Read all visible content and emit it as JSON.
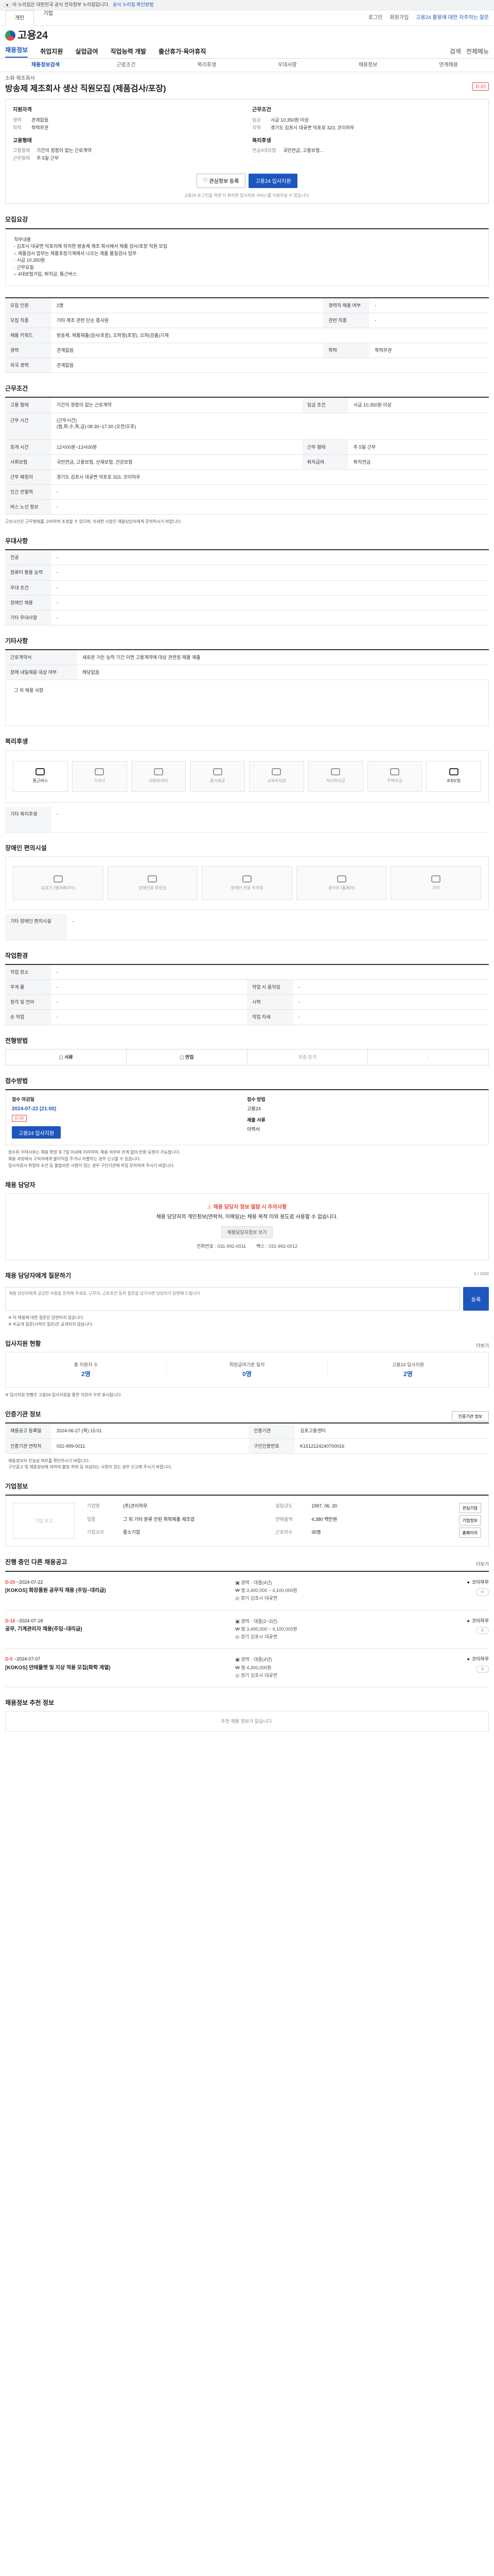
{
  "gov_banner": {
    "text": "이 누리집은 대한민국 공식 전자정부 누리집입니다.",
    "link": "공식 누리집 확인방법"
  },
  "util": {
    "tabs": [
      "개인",
      "기업"
    ],
    "right": [
      "로그인",
      "회원가입",
      "고용24 활용에 대한 자주하는 질문"
    ],
    "notice": "로그인 없이 이용"
  },
  "logo": "고용24",
  "gnb": {
    "items": [
      "채용정보",
      "취업지원",
      "실업급여",
      "직업능력 개발",
      "출산휴가·육아휴직"
    ],
    "icons": [
      "검색",
      "전체메뉴"
    ]
  },
  "subnav": [
    "채용정보검색",
    "근로조건",
    "복리후생",
    "우대사항",
    "채용정보",
    "연계채용"
  ],
  "posting": {
    "company": "소화 제조회사",
    "title": "방송제 제조회사 생산 직원모집 (제품검사/포장)",
    "dday": "D-20"
  },
  "summary": {
    "left_title": "지원자격",
    "left": [
      {
        "k": "경력",
        "v": "관계없음"
      },
      {
        "k": "학력",
        "v": "학력무관"
      }
    ],
    "right_title": "근무조건",
    "right": [
      {
        "k": "임금",
        "v": "시급 10,350원 이상"
      },
      {
        "k": "지역",
        "v": "경기도 김포시 대곶면 덕포로 323, 코이하우"
      }
    ],
    "employ_title": "고용형태",
    "employ": [
      {
        "k": "고용형태",
        "v": "기간의 정함이 없는 근로계약"
      },
      {
        "k": "근무형태",
        "v": "주 5일 근무"
      }
    ],
    "welfare_title": "복리후생",
    "welfare": [
      {
        "k": "연금4대보험",
        "v": "국민연금, 고용보험..."
      }
    ],
    "btn_scrap": "관심정보 등록",
    "btn_apply": "고용24 입사지원",
    "note": "고용24 로그인을 하면 더 편리한 입사지원 서비스를 이용하실 수 있습니다."
  },
  "job_desc": {
    "title": "모집요강",
    "body": "직무내용\n- 김포시 대곶면 덕포리에 위치한 방송제 제조 회사에서 제품 검사/포장 직원 모집\n  ○ 제품검사 업무는 제품포장기계에서 나오는 제품 품질검사 업무\n    · 시급 10,350원\n    · 근무요일\n  ○ 4대보험가입, 퇴직금, 통근버스"
  },
  "recruit": {
    "title": "모집요강",
    "rows": [
      {
        "k": "모집 인원",
        "v": "2명",
        "k2": "경력직 채용 여부",
        "v2": "-"
      },
      {
        "k": "모집 직종",
        "v": "기타 제조 관련 단순 종사원",
        "k2": "관련 직종",
        "v2": "-"
      },
      {
        "k": "채용 키워드",
        "v": "방송제, 제품제출(검사/포장), 오퍼정(포장), 오퍼(검출)기계",
        "k2": "",
        "v2": ""
      },
      {
        "k": "경력",
        "v": "관계없음",
        "k2": "학력",
        "v2": "학력무관"
      },
      {
        "k": "외국 경력",
        "v": "관계없음",
        "k2": "",
        "v2": ""
      }
    ]
  },
  "conditions": {
    "title": "근무조건",
    "rows": [
      {
        "k": "고용 형태",
        "v": "기간의 정함이 없는 근로계약",
        "k2": "임금 조건",
        "v2": "시급 10,350원 이상"
      },
      {
        "k": "근무 시간",
        "v": "(근무시간)\n(월,화,수,목,금) 08:30~17:30 (오전/오후)",
        "k2": "",
        "v2": ""
      },
      {
        "k": "휴게 시간",
        "v": "12시00분~13시00분",
        "k2": "근무 형태",
        "v2": "주 5일 근무"
      },
      {
        "k": "사회보험",
        "v": "국민연금, 고용보험, 산재보험, 건강보험",
        "k2": "퇴직급여",
        "v2": "퇴직연금"
      },
      {
        "k": "근무 예정지",
        "v": "경기도 김포시 대곶면 덕포로 323, 코이하우",
        "k2": "",
        "v2": ""
      },
      {
        "k": "인근 전철역",
        "v": "-",
        "k2": "",
        "v2": ""
      },
      {
        "k": "버스 노선 정보",
        "v": "-",
        "k2": "",
        "v2": ""
      }
    ],
    "note": "근로시간은 근무형태를 고려하여 조정할 수 있으며, 자세한 사항은 채용담당자에게 문의하시기 바랍니다."
  },
  "prefer": {
    "title": "우대사항",
    "rows": [
      {
        "k": "전공",
        "v": "-"
      },
      {
        "k": "컴퓨터 활용 능력",
        "v": "-"
      },
      {
        "k": "우대 조건",
        "v": "-"
      },
      {
        "k": "장애인 채용",
        "v": "-"
      },
      {
        "k": "기타 우대사항",
        "v": "-"
      }
    ]
  },
  "etc": {
    "title": "기타사항",
    "rows": [
      {
        "k": "근로계약서",
        "v": "새로운 거든 능력 기간 이면 고용계약에 대상 관련된 제품 제출"
      },
      {
        "k": "장애 내일채움 대상 여부",
        "v": "해당없음"
      }
    ],
    "more": "그 외 채용 사항"
  },
  "welfare": {
    "title": "복리후생",
    "items": [
      {
        "label": "통근버스",
        "on": true
      },
      {
        "label": "기숙사",
        "on": false
      },
      {
        "label": "차량유지비",
        "on": false
      },
      {
        "label": "중식제공",
        "on": false
      },
      {
        "label": "교육비지원",
        "on": false
      },
      {
        "label": "자녀학자금",
        "on": false
      },
      {
        "label": "주택자금",
        "on": false
      },
      {
        "label": "4대보험",
        "on": true
      }
    ],
    "etc_label": "기타 복리후생",
    "etc_value": "-"
  },
  "disabled": {
    "title": "장애인 편의시설",
    "items": [
      "승강기 (엘리베이터)",
      "장애인용 화장실",
      "장애인 전용 주차장",
      "경사로 (휠체어)",
      "기타"
    ],
    "etc_label": "기타 장애인 편의시설",
    "etc_value": "-"
  },
  "work_env": {
    "title": "작업환경",
    "rows": [
      {
        "k": "작업 장소",
        "v": "-",
        "k2": "",
        "v2": ""
      },
      {
        "k": "무게 물",
        "v": "-",
        "k2": "작업 시 움직임",
        "v2": "-"
      },
      {
        "k": "청각 및 언어",
        "v": "-",
        "k2": "시력",
        "v2": "-"
      },
      {
        "k": "손 작업",
        "v": "-",
        "k2": "작업 자세",
        "v2": "-"
      }
    ]
  },
  "process": {
    "title": "전형방법",
    "steps": [
      "서류",
      "면접",
      "최종 합격",
      "-"
    ]
  },
  "apply": {
    "title": "접수방법",
    "col1_title": "접수 마감일",
    "date": "2024-07-22 (21:00)",
    "dday": "D-20",
    "col2_title": "접수 방법",
    "method": "고용24",
    "docs_title": "제출 서류",
    "docs": "이력서",
    "btn": "고용24 입사지원",
    "notes": [
      "접수된 이력서류는 채용 확정 후 7일 이내에 처리하며, 채용 여부와 관계 없이 반환 요청이 가능합니다.",
      "채용 과정에서 구직자에게 불이익을 주거나 차별하는 경우 신고할 수 있습니다.",
      "입사지원시 취업의 조건 등 불합리한 사항이 있는 경우 구인기관에 직접 문의하여 주시기 바랍니다."
    ]
  },
  "manager": {
    "title": "채용 담당자",
    "alert": "채용 담당자 정보 열람 시 주의사항",
    "desc": "채용 담당자의 개인정보(연락처, 이메일)는 채용 목적 이외 용도로 사용할 수 없습니다.",
    "btn": "채용담당자정보 보기",
    "tel_label": "전화번호",
    "tel": "031-992-0011",
    "fax_label": "팩스",
    "fax": "031-992-0012"
  },
  "qa": {
    "title": "채용 담당자에게 질문하기",
    "count": "0 / 1000",
    "placeholder": "채용 담당자에게 궁금한 사항을 문의해 주세요. 근무지, 근로조건 등의 질문을 남기시면 담당자가 답변해 드립니다.",
    "btn": "등록",
    "notes": [
      "※ 타 채용에 대한 질문은 답변되지 않습니다.",
      "※ 비공개 질문(사적인 질문)은 공개되지 않습니다."
    ]
  },
  "status": {
    "title": "입사지원 현황",
    "more": "더보기",
    "items": [
      {
        "label": "총 지원자 수",
        "value": "2명"
      },
      {
        "label": "희망급여기준 일치",
        "value": "0명"
      },
      {
        "label": "고용24 입사지원",
        "value": "2명"
      }
    ],
    "note": "※ 입사지원 현황은 고용24 입사지원을 통한 지원자 수만 표시됩니다."
  },
  "info": {
    "title": "인증기관 정보",
    "more_btn": "인증기관 정보",
    "rows": [
      {
        "k": "채용공고 등록일",
        "v": "2024-06-27 (목) 15:01",
        "k2": "인증기관",
        "v2": "김포고용센터"
      },
      {
        "k": "인증기관 연락처",
        "v": "031-999-0011",
        "k2": "구인인증번호",
        "v2": "K1512124240700016"
      }
    ],
    "notes": [
      "채용정보의 진실성 여부를 확인하시기 바랍니다.",
      "구인광고 및 채용정보에 대하여 불법·허위 등 의심되는 사항이 있는 경우 신고해 주시기 바랍니다."
    ]
  },
  "company": {
    "title": "기업정보",
    "logo_alt": "기업 로고",
    "info": [
      {
        "k": "기업명",
        "v": "(주)코이하우"
      },
      {
        "k": "업종",
        "v": "그 외 기타 분류 안된 화학제품 제조업"
      },
      {
        "k": "설립년도",
        "v": "1997. 06. 20"
      },
      {
        "k": "연매출액",
        "v": "4,380 백만원"
      },
      {
        "k": "근로자수",
        "v": "35명"
      },
      {
        "k": "기업규모",
        "v": "중소기업"
      }
    ],
    "btns": [
      "관심기업",
      "기업정보",
      "홈페이지"
    ]
  },
  "other_posts": {
    "title": "진행 중인 다른 채용공고",
    "more": "더보기",
    "items": [
      {
        "dday": "D-20",
        "date": "~2024-07-22",
        "title": "[KOKOS] 화장품원 공무직 채용 (주임~대리급)",
        "career": "경력",
        "edu": "대졸(4년)",
        "pay": "월 3,400,000 ~ 4,100,000원",
        "region": "경기 김포시 대곶면",
        "org": "코이하우"
      },
      {
        "dday": "D-16",
        "date": "~2024-07-18",
        "title": "공무, 기계관리자 채용(주임~대리급)",
        "career": "경력",
        "edu": "대졸(2~3년)",
        "pay": "월 3,400,000 ~ 4,100,000원",
        "region": "경기 김포시 대곶면",
        "org": "코이하우"
      },
      {
        "dday": "D-5",
        "date": "~2024-07-07",
        "title": "[KOKOS] 안테플랫 및 지상 적용 모집(화학 계열)",
        "career": "경력",
        "edu": "대졸(4년)",
        "pay": "월 4,300,000원",
        "region": "경기 김포시 대곶면",
        "org": "코이하우"
      }
    ]
  },
  "recommend": {
    "title": "채용정보 추천 정보",
    "empty": "추천 채용 정보가 없습니다."
  }
}
